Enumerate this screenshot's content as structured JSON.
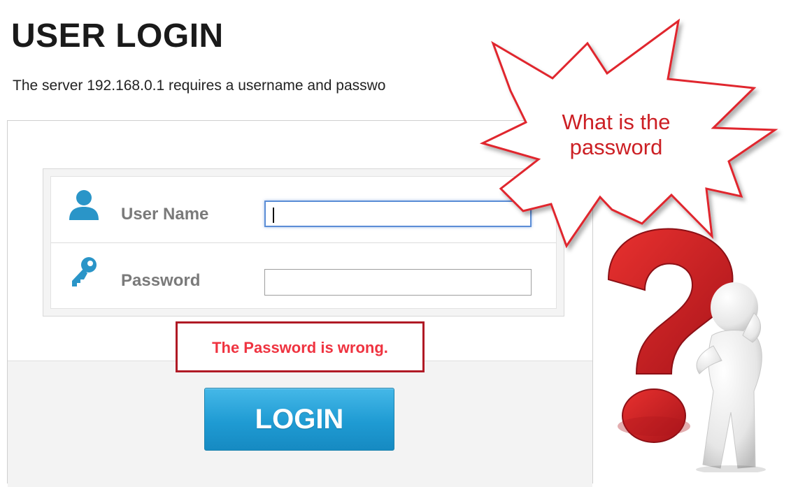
{
  "header": {
    "title": "USER LOGIN",
    "server_message": "The server  192.168.0.1  requires a username and passwo"
  },
  "form": {
    "username": {
      "label": "User Name",
      "value": "",
      "icon": "user-icon",
      "focused": true
    },
    "password": {
      "label": "Password",
      "value": "",
      "icon": "key-icon"
    }
  },
  "error": {
    "message": "The Password is wrong."
  },
  "login_button": {
    "label": "LOGIN"
  },
  "callout": {
    "line1": "What is the",
    "line2": "password"
  },
  "illustration": {
    "icon": "question-mark-figure-icon"
  },
  "colors": {
    "title_text": "#1a1a1a",
    "accent_blue": "#1f9bd3",
    "icon_blue": "#2a95c8",
    "error_red": "#ef3340",
    "error_border": "#b01a25",
    "callout_red": "#cc1f24",
    "question_red": "#d4191f"
  }
}
